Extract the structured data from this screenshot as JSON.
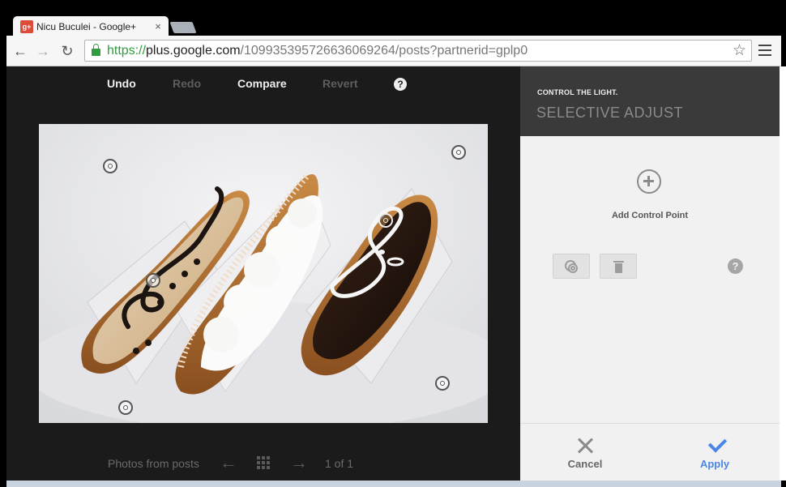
{
  "browser": {
    "tab_title": "Nicu Buculei - Google+",
    "favicon_text": "g+",
    "tab_close": "×",
    "url": {
      "scheme": "https://",
      "host": "plus.google.com",
      "path": "/109935395726636069264/posts?partnerid=gplp0"
    },
    "icons": {
      "back": "←",
      "forward": "→",
      "reload": "↻",
      "star": "☆"
    }
  },
  "editor": {
    "undo": "Undo",
    "redo": "Redo",
    "compare": "Compare",
    "revert": "Revert",
    "help": "?",
    "photo_subject": "Three eclairs on a white paper doily",
    "bottom": {
      "photos_from_posts": "Photos from posts",
      "prev": "←",
      "next": "→",
      "pager": "1 of 1"
    }
  },
  "panel": {
    "subtitle": "CONTROL THE LIGHT.",
    "title": "SELECTIVE ADJUST",
    "add_control_point": "Add Control Point",
    "help": "?",
    "cancel": "Cancel",
    "apply": "Apply"
  },
  "colors": {
    "accent": "#4a86e8",
    "editor_bg": "#1b1b1b",
    "panel_bg": "#f1f1f1",
    "panel_header": "#3a3a3a"
  }
}
